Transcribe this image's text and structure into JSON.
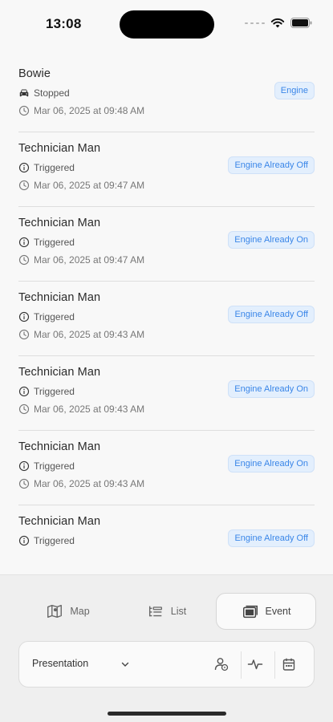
{
  "status": {
    "time": "13:08"
  },
  "events": [
    {
      "title": "Bowie",
      "status": "Stopped",
      "status_icon": "car-icon",
      "timestamp": "Mar 06, 2025 at 09:48 AM",
      "badge": "Engine"
    },
    {
      "title": "Technician Man",
      "status": "Triggered",
      "status_icon": "info-icon",
      "timestamp": "Mar 06, 2025 at 09:47 AM",
      "badge": "Engine Already Off"
    },
    {
      "title": "Technician Man",
      "status": "Triggered",
      "status_icon": "info-icon",
      "timestamp": "Mar 06, 2025 at 09:47 AM",
      "badge": "Engine Already On"
    },
    {
      "title": "Technician Man",
      "status": "Triggered",
      "status_icon": "info-icon",
      "timestamp": "Mar 06, 2025 at 09:43 AM",
      "badge": "Engine Already Off"
    },
    {
      "title": "Technician Man",
      "status": "Triggered",
      "status_icon": "info-icon",
      "timestamp": "Mar 06, 2025 at 09:43 AM",
      "badge": "Engine Already On"
    },
    {
      "title": "Technician Man",
      "status": "Triggered",
      "status_icon": "info-icon",
      "timestamp": "Mar 06, 2025 at 09:43 AM",
      "badge": "Engine Already On"
    },
    {
      "title": "Technician Man",
      "status": "Triggered",
      "status_icon": "info-icon",
      "timestamp": "",
      "badge": "Engine Already Off"
    }
  ],
  "tabs": [
    {
      "label": "Map",
      "icon": "map-icon",
      "active": false
    },
    {
      "label": "List",
      "icon": "list-icon",
      "active": false
    },
    {
      "label": "Event",
      "icon": "event-icon",
      "active": true
    }
  ],
  "controls": {
    "select_value": "Presentation",
    "buttons": [
      "driver-icon",
      "activity-icon",
      "calendar-icon"
    ]
  },
  "colors": {
    "badge_bg": "#e3effd",
    "badge_text": "#3a86e8",
    "background": "#f8f8f8"
  }
}
